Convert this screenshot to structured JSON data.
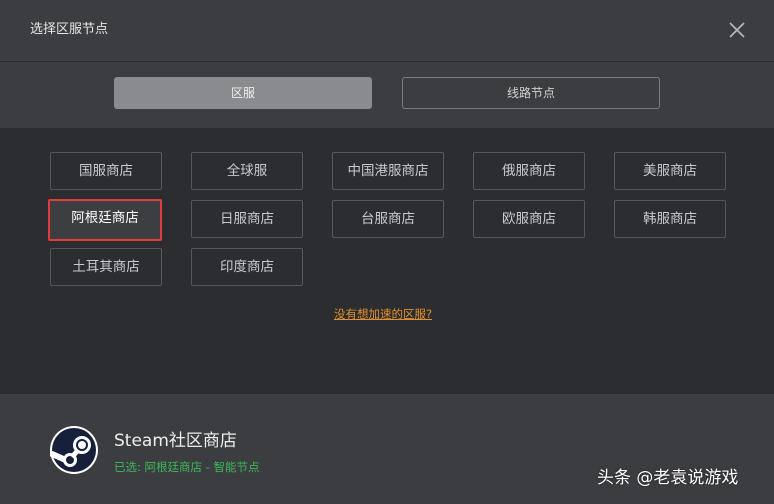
{
  "dialog": {
    "title": "选择区服节点",
    "close_icon": "close-icon"
  },
  "tabs": [
    {
      "label": "区服",
      "active": true
    },
    {
      "label": "线路节点",
      "active": false
    }
  ],
  "servers": [
    {
      "label": "国服商店",
      "selected": false
    },
    {
      "label": "全球服",
      "selected": false
    },
    {
      "label": "中国港服商店",
      "selected": false
    },
    {
      "label": "俄服商店",
      "selected": false
    },
    {
      "label": "美服商店",
      "selected": false
    },
    {
      "label": "阿根廷商店",
      "selected": true
    },
    {
      "label": "日服商店",
      "selected": false
    },
    {
      "label": "台服商店",
      "selected": false
    },
    {
      "label": "欧服商店",
      "selected": false
    },
    {
      "label": "韩服商店",
      "selected": false
    },
    {
      "label": "土耳其商店",
      "selected": false
    },
    {
      "label": "印度商店",
      "selected": false
    }
  ],
  "missing_region_link": "没有想加速的区服?",
  "footer": {
    "logo_icon": "steam-logo-icon",
    "game_name": "Steam社区商店",
    "selected_status": "已选: 阿根廷商店 - 智能节点"
  },
  "watermark": "头条 @老袁说游戏",
  "colors": {
    "selected_border": "#e03c3c",
    "link": "#e0902c",
    "status_green": "#3cb85a",
    "active_tab": "#8a8b8e"
  }
}
